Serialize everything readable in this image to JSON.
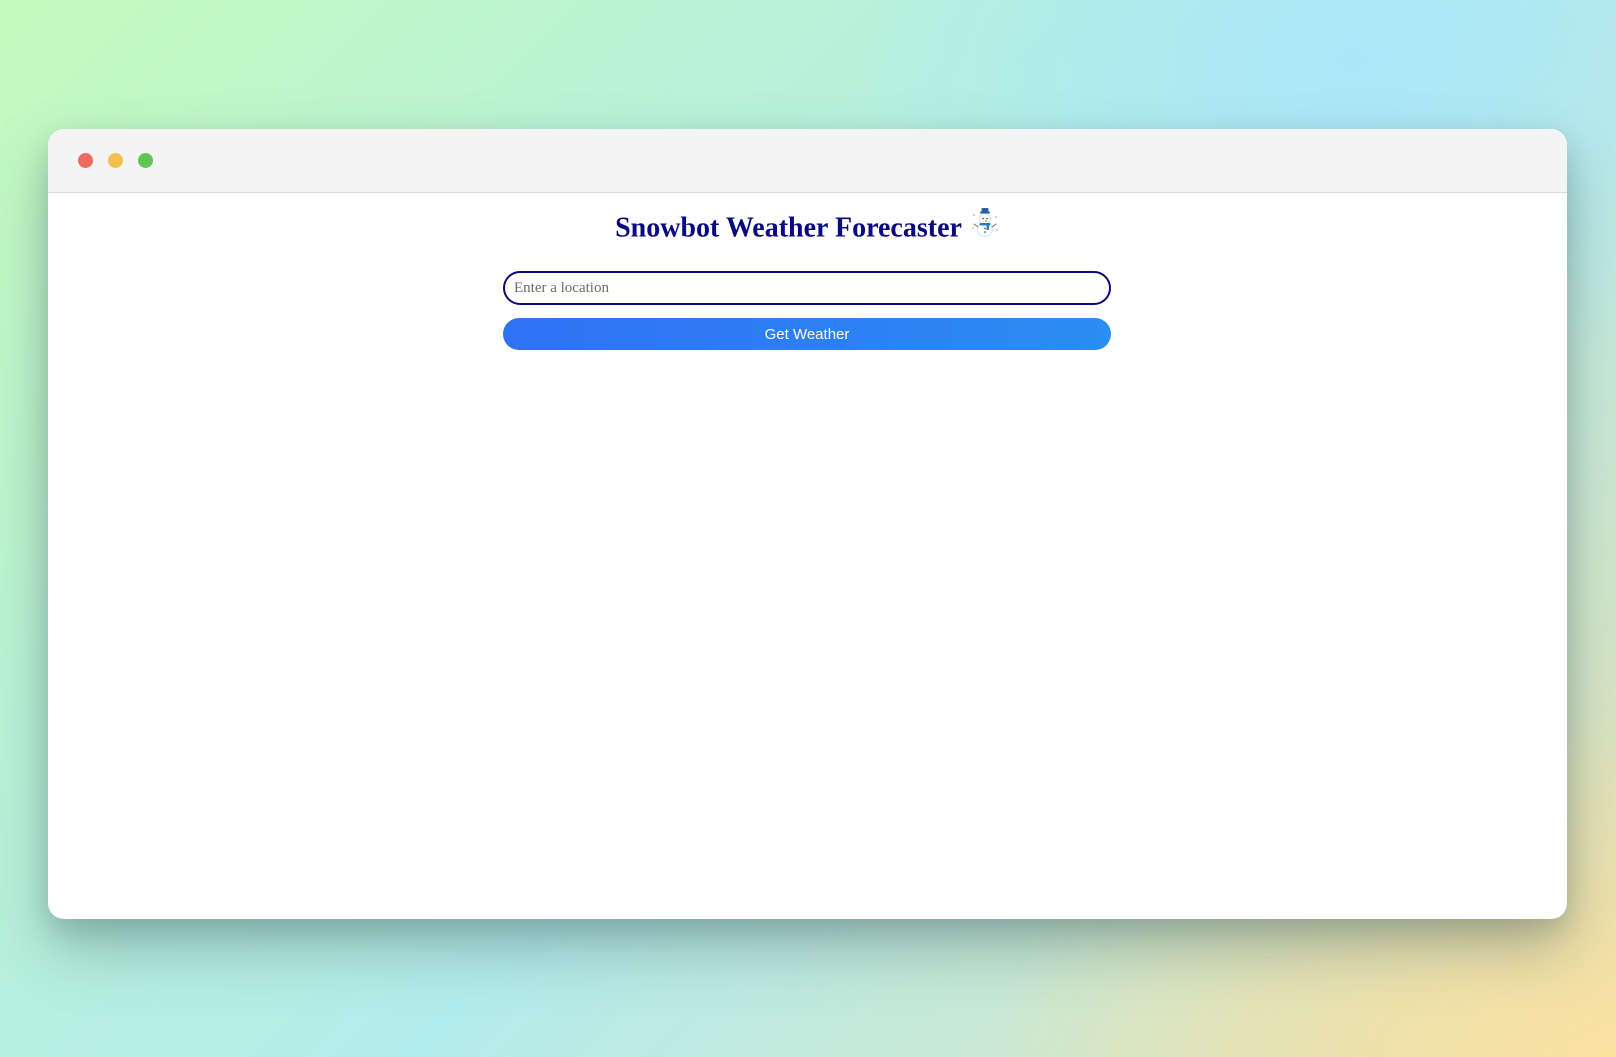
{
  "window": {
    "controls": {
      "close_color": "#ec6a5e",
      "minimize_color": "#f4bf4f",
      "maximize_color": "#61c554"
    }
  },
  "app": {
    "title": "Snowbot Weather Forecaster",
    "title_icon": "snowman-icon",
    "title_color": "#0a0a80"
  },
  "search": {
    "placeholder": "Enter a location",
    "value": ""
  },
  "actions": {
    "get_weather_label": "Get Weather",
    "button_color": "#2f7ff5"
  }
}
